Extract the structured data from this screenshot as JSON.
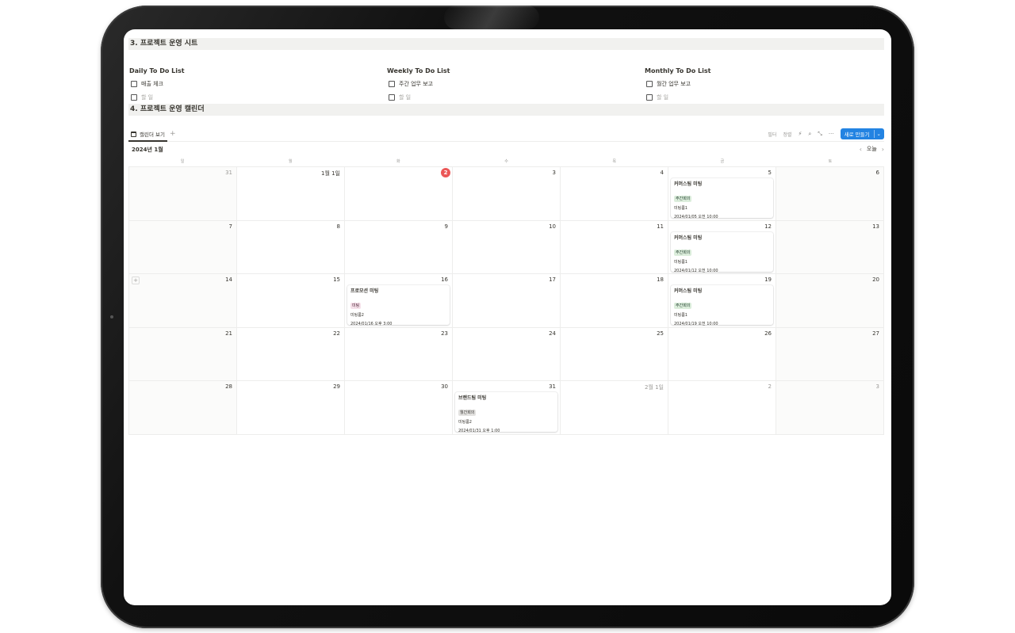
{
  "section3": {
    "title": "3. 프로젝트 운영 시트",
    "lists": [
      {
        "title": "Daily To Do List",
        "items": [
          "매출 체크"
        ],
        "placeholder": "할 일"
      },
      {
        "title": "Weekly To Do List",
        "items": [
          "주간 업무 보고"
        ],
        "placeholder": "할 일"
      },
      {
        "title": "Monthly To Do List",
        "items": [
          "월간 업무 보고"
        ],
        "placeholder": "할 일"
      }
    ]
  },
  "section4": {
    "title": "4. 프로젝트 운영 캘린더",
    "tab_label": "캘린더 보기",
    "tab_add": "+",
    "toolbar": {
      "filter": "필터",
      "sort": "정렬",
      "new_button": "새로 만들기"
    },
    "month_label": "2024년 1월",
    "today_label": "오늘",
    "weekdays": [
      "일",
      "월",
      "화",
      "수",
      "목",
      "금",
      "토"
    ],
    "days": [
      [
        "31",
        "1월 1일",
        "2",
        "3",
        "4",
        "5",
        "6"
      ],
      [
        "7",
        "8",
        "9",
        "10",
        "11",
        "12",
        "13"
      ],
      [
        "14",
        "15",
        "16",
        "17",
        "18",
        "19",
        "20"
      ],
      [
        "21",
        "22",
        "23",
        "24",
        "25",
        "26",
        "27"
      ],
      [
        "28",
        "29",
        "30",
        "31",
        "2월 1일",
        "2",
        "3"
      ]
    ],
    "events": {
      "w0d5": {
        "title": "커머스팀 미팅",
        "tag": "주간회의",
        "room": "미팅룸1",
        "datetime": "2024/01/05 오전 10:00"
      },
      "w1d5": {
        "title": "커머스팀 미팅",
        "tag": "주간회의",
        "room": "미팅룸1",
        "datetime": "2024/01/12 오전 10:00"
      },
      "w2d2": {
        "title": "프로모션 미팅",
        "tag": "미팅",
        "room": "미팅룸2",
        "datetime": "2024/01/16 오후 3:00"
      },
      "w2d5": {
        "title": "커머스팀 미팅",
        "tag": "주간회의",
        "room": "미팅룸1",
        "datetime": "2024/01/19 오전 10:00"
      },
      "w4d3": {
        "title": "브랜드팀 미팅",
        "tag": "월간회의",
        "room": "미팅룸2",
        "datetime": "2024/01/31 오후 1:00"
      }
    }
  },
  "colors": {
    "accent": "#2383e2",
    "today": "#eb5757",
    "tag_green": "#dbeddb",
    "tag_pink": "#f5e0e9",
    "tag_gray": "#e3e2e0"
  },
  "icons": [
    "calendar-icon",
    "lightning-icon",
    "search-icon",
    "resize-icon",
    "more-icon",
    "chevron-left-icon",
    "chevron-right-icon",
    "chevron-down-icon",
    "plus-icon"
  ]
}
